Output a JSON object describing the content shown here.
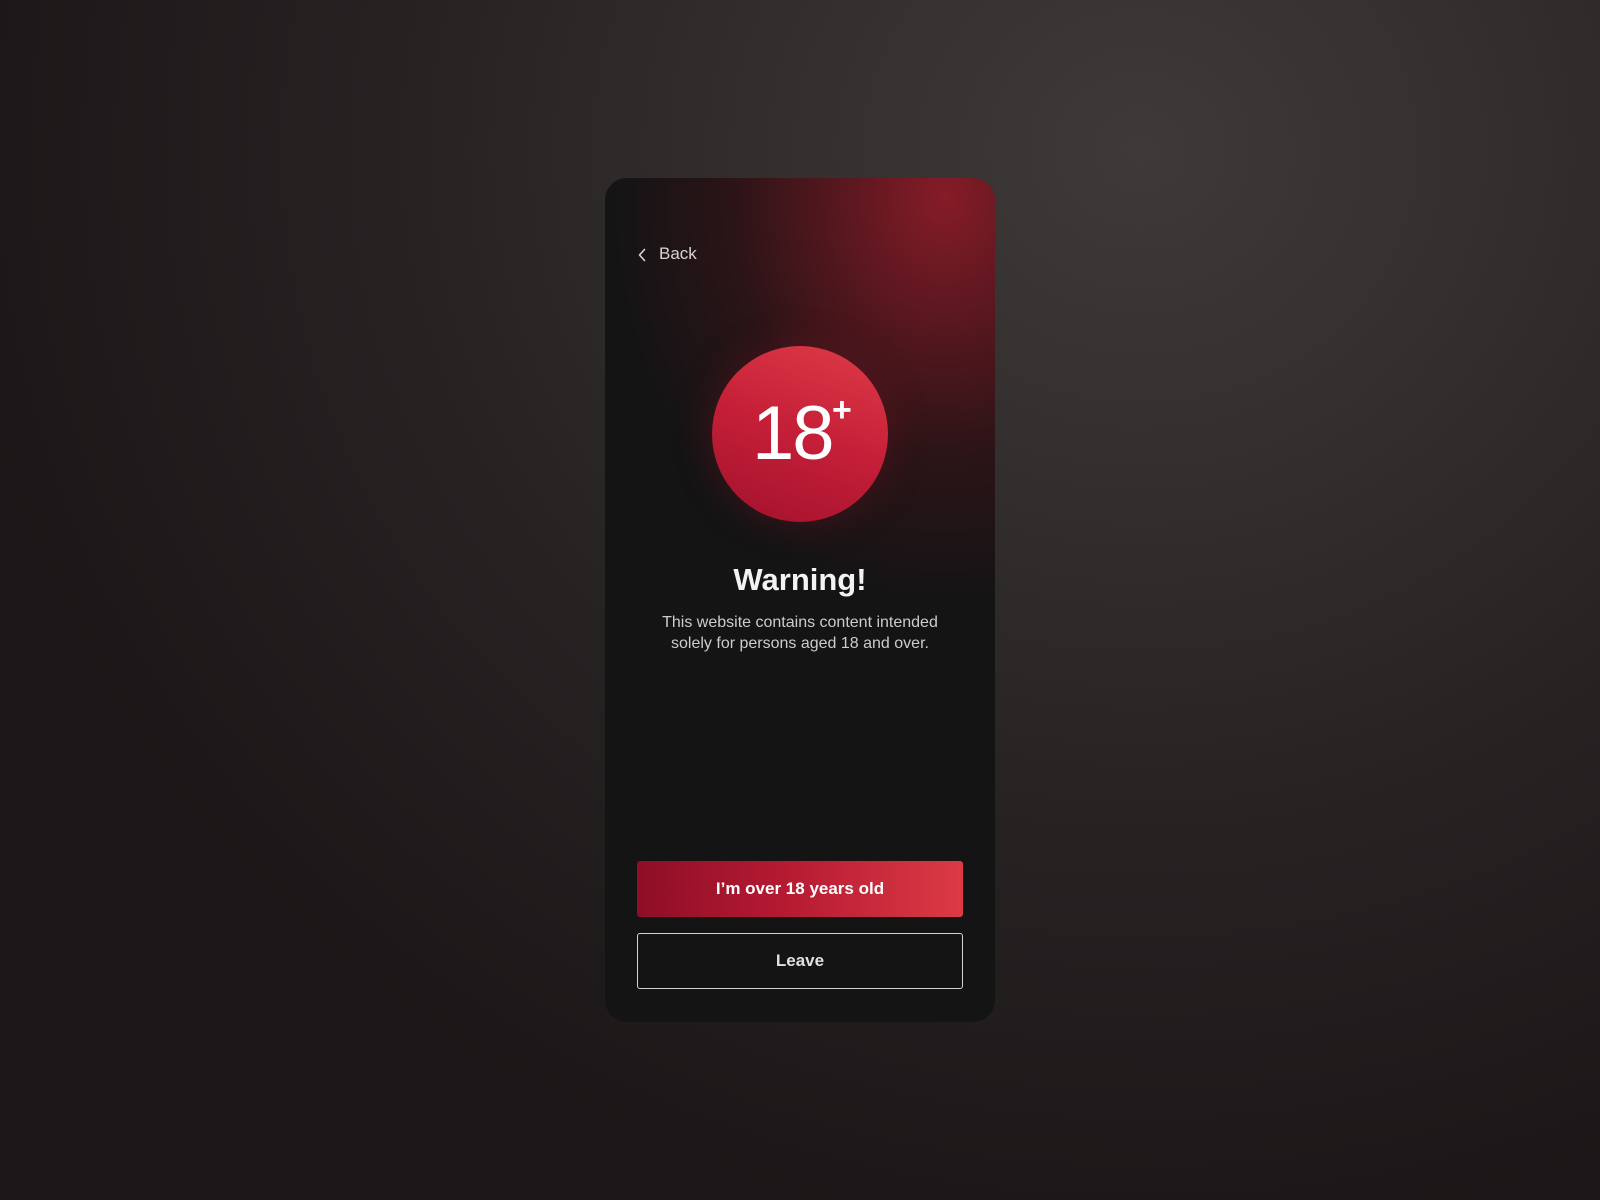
{
  "screen": {
    "back_label": "Back",
    "badge": {
      "number": "18",
      "superscript": "+"
    },
    "title": "Warning!",
    "description": "This website contains content intended solely for persons aged 18 and over.",
    "primary_button_label": "I’m over 18 years old",
    "secondary_button_label": "Leave"
  },
  "icons": {
    "back": "chevron-left-icon"
  },
  "colors": {
    "accent": "#c51f38",
    "accent_dark": "#8e0e27",
    "accent_light": "#dc3a45",
    "card_background": "#141415",
    "page_background": "#2a2626",
    "text_primary": "#f4f2f2",
    "text_secondary": "#cfcbcb"
  }
}
